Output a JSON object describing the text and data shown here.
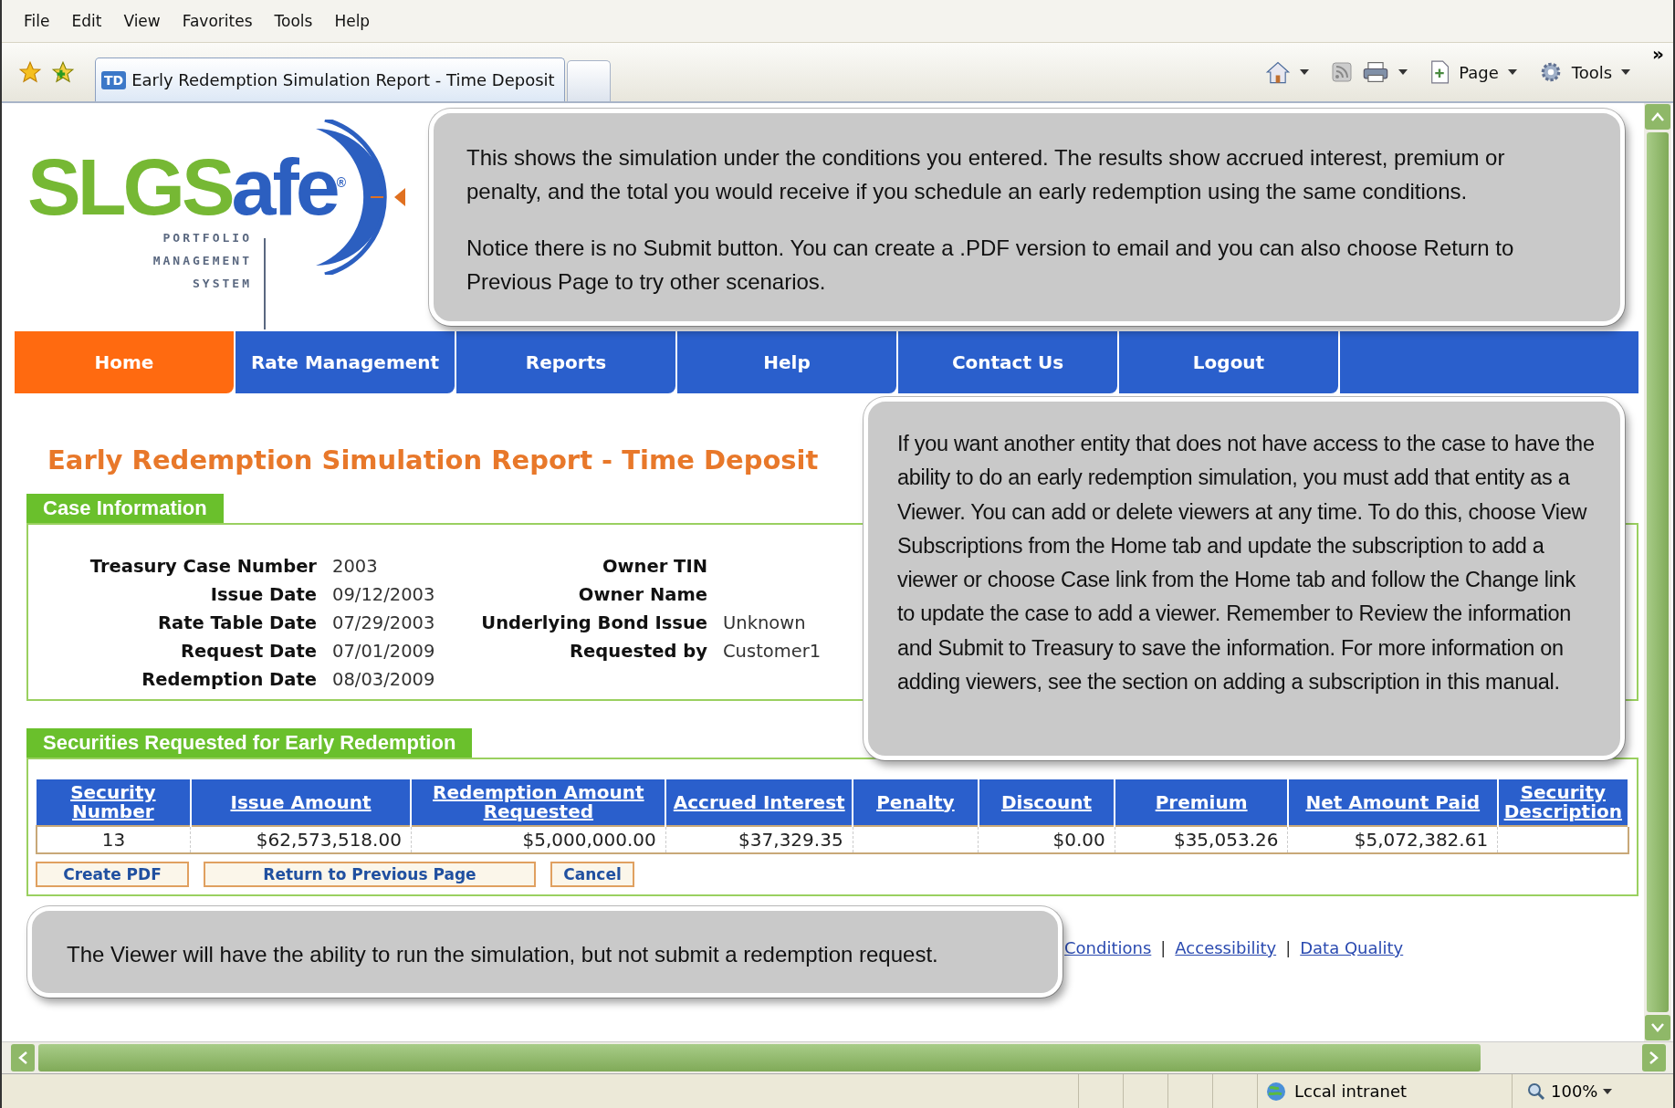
{
  "menu_bar": [
    "File",
    "Edit",
    "View",
    "Favorites",
    "Tools",
    "Help"
  ],
  "browser_tab": {
    "icon_text": "TD",
    "title": "Early Redemption Simulation Report - Time Deposit"
  },
  "command_bar": {
    "page_label": "Page",
    "tools_label": "Tools",
    "overflow": "»"
  },
  "logo": {
    "part1": "SLGS",
    "part2": "afe",
    "mark": "®",
    "tagline": [
      "PORTFOLIO",
      "MANAGEMENT",
      "SYSTEM"
    ]
  },
  "nav_tabs": [
    {
      "label": "Home",
      "selected": true
    },
    {
      "label": "Rate Management",
      "selected": false
    },
    {
      "label": "Reports",
      "selected": false
    },
    {
      "label": "Help",
      "selected": false
    },
    {
      "label": "Contact Us",
      "selected": false
    },
    {
      "label": "Logout",
      "selected": false
    }
  ],
  "page_title": "Early Redemption Simulation Report - Time Deposit",
  "case_information": {
    "heading": "Case Information",
    "fields": [
      {
        "label": "Treasury Case Number",
        "value": "2003"
      },
      {
        "label": "Owner TIN"
      },
      {
        "label": "Issue Date",
        "value": "09/12/2003"
      },
      {
        "label": "Owner Name"
      },
      {
        "label": "Rate Table Date",
        "value": "07/29/2003"
      },
      {
        "label": "Underlying Bond Issue",
        "value": "Unknown"
      },
      {
        "label": "Request Date",
        "value": "07/01/2009"
      },
      {
        "label": "Requested by",
        "value": "Customer1"
      },
      {
        "label": "Redemption Date",
        "value": "08/03/2009"
      }
    ]
  },
  "securities": {
    "heading": "Securities Requested for Early Redemption",
    "columns": [
      "Security Number",
      "Issue Amount",
      "Redemption Amount Requested",
      "Accrued Interest",
      "Penalty",
      "Discount",
      "Premium",
      "Net Amount Paid",
      "Security Description"
    ],
    "rows": [
      {
        "cells": [
          "13",
          "$62,573,518.00",
          "$5,000,000.00",
          "$37,329.35",
          null,
          "$0.00",
          "$35,053.26",
          "$5,072,382.61",
          null
        ]
      }
    ],
    "buttons": [
      "Create PDF",
      "Return to Previous Page",
      "Cancel"
    ]
  },
  "footer_links": [
    "Conditions",
    "Accessibility",
    "Data Quality"
  ],
  "link_separator": "|",
  "callouts": [
    {
      "paragraphs": [
        "This shows the simulation under the conditions you entered. The results show accrued interest, premium or penalty, and the total you would receive if you schedule an early redemption using the same conditions.",
        "Notice there is no Submit button. You can create a .PDF version to email and you can also choose Return to Previous Page to try other scenarios."
      ]
    },
    {
      "paragraphs": [
        "If you want another entity that does not have access to the case to have the ability to do an early redemption simulation, you must add that entity as a Viewer. You can add or delete viewers at any time. To do this, choose View Subscriptions from the Home tab and update the subscription to add a viewer or choose Case link from the Home tab and follow the Change link to update the case to add a viewer. Remember to Review the information and Submit to Treasury to save the information. For more information on adding viewers, see the section on adding a subscription in this manual."
      ]
    },
    {
      "paragraphs": [
        "The Viewer will have the ability to run the simulation, but not submit a redemption request."
      ]
    }
  ],
  "status_bar": {
    "zone": "Lccal intranet",
    "zoom": "100%"
  }
}
